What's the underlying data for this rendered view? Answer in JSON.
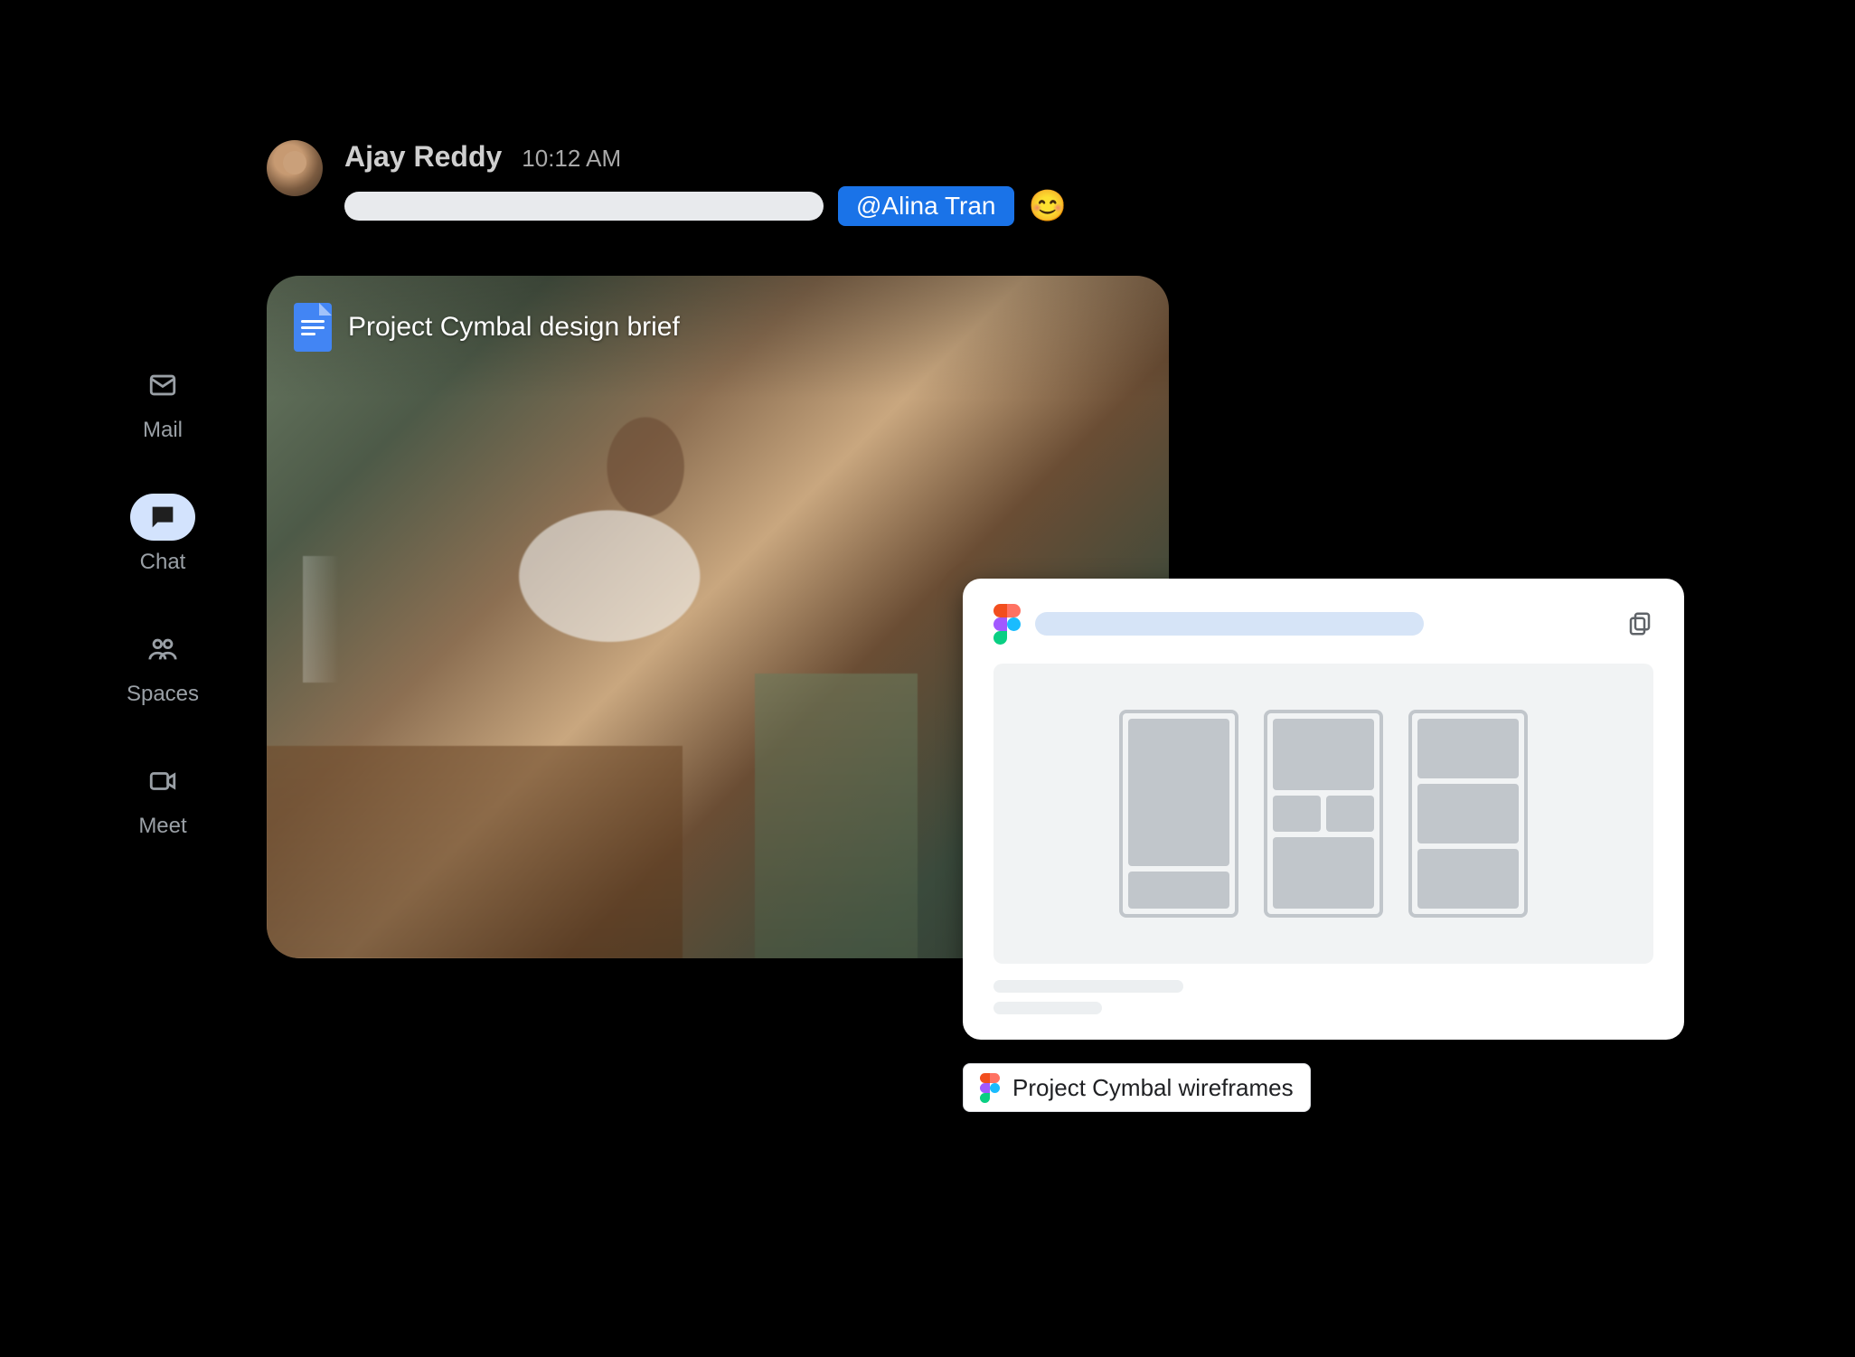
{
  "nav": {
    "items": [
      {
        "id": "mail",
        "label": "Mail",
        "icon": "mail-icon",
        "active": false
      },
      {
        "id": "chat",
        "label": "Chat",
        "icon": "chat-icon",
        "active": true
      },
      {
        "id": "spaces",
        "label": "Spaces",
        "icon": "spaces-icon",
        "active": false
      },
      {
        "id": "meet",
        "label": "Meet",
        "icon": "meet-icon",
        "active": false
      }
    ]
  },
  "message": {
    "sender_name": "Ajay Reddy",
    "timestamp": "10:12 AM",
    "mention_text": "@Alina Tran",
    "reaction_emoji": "😊"
  },
  "doc_attachment": {
    "icon": "google-docs-icon",
    "title": "Project Cymbal design brief"
  },
  "figma_attachment": {
    "chip_label": "Project Cymbal wireframes"
  },
  "colors": {
    "accent_blue": "#1a73e8",
    "nav_active_bg": "#d3e3fd"
  }
}
